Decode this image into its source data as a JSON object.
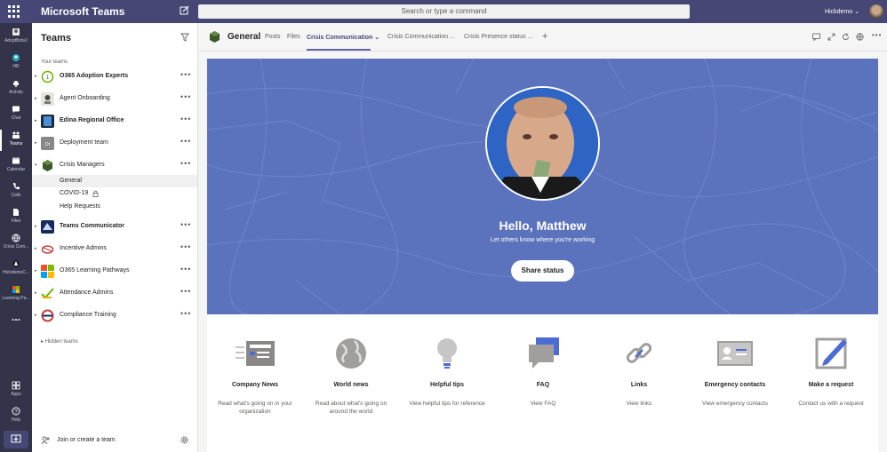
{
  "topbar": {
    "app_title": "Microsoft Teams",
    "search_placeholder": "Search or type a command",
    "user_name": "Hickdemo ⌄"
  },
  "rail": [
    {
      "label": "AdoptBotv2",
      "icon": "bot-icon"
    },
    {
      "label": "HR",
      "icon": "hr-icon"
    },
    {
      "label": "Activity",
      "icon": "bell-icon"
    },
    {
      "label": "Chat",
      "icon": "chat-icon"
    },
    {
      "label": "Teams",
      "icon": "teams-icon",
      "active": true
    },
    {
      "label": "Calendar",
      "icon": "calendar-icon"
    },
    {
      "label": "Calls",
      "icon": "phone-icon"
    },
    {
      "label": "Files",
      "icon": "file-icon"
    },
    {
      "label": "Crisis Com...",
      "icon": "globe-icon"
    },
    {
      "label": "HickdemoC...",
      "icon": "app-icon"
    },
    {
      "label": "Learning Pa...",
      "icon": "learning-icon"
    },
    {
      "label": "...",
      "icon": "more-icon"
    },
    {
      "label": "Apps",
      "icon": "apps-icon"
    },
    {
      "label": "Help",
      "icon": "help-icon"
    }
  ],
  "pane": {
    "title": "Teams",
    "your_teams": "Your teams",
    "hidden_teams": "Hidden teams",
    "join_label": "Join or create a team",
    "teams": [
      {
        "name": "O365 Adoption Experts",
        "bold": true
      },
      {
        "name": "Agent Onboarding",
        "bold": false
      },
      {
        "name": "Edina Regional Office",
        "bold": true
      },
      {
        "name": "Deployment team",
        "bold": false
      },
      {
        "name": "Crisis Managers",
        "bold": false
      },
      {
        "name": "Teams Communicator",
        "bold": true
      },
      {
        "name": "Incentive Admins",
        "bold": false
      },
      {
        "name": "O365 Learning Pathways",
        "bold": false
      },
      {
        "name": "Attendance Admins",
        "bold": false
      },
      {
        "name": "Compliance Training",
        "bold": false
      }
    ],
    "channels": [
      "General",
      "COVID-19",
      "Help Requests"
    ],
    "more": "•••"
  },
  "header": {
    "channel": "General",
    "tabs": [
      "Posts",
      "Files",
      "Crisis Communication ⌄",
      "Crisis Communication ...",
      "Crisis Presence status ..."
    ],
    "add": "+"
  },
  "hero": {
    "greeting": "Hello, Matthew",
    "subtitle": "Let others know where you're working",
    "button": "Share status",
    "color": "#5b72bd"
  },
  "tiles": [
    {
      "title": "Company News",
      "desc": "Read what's going on in your organization",
      "icon": "news-icon"
    },
    {
      "title": "World news",
      "desc": "Read about what's going on around the world",
      "icon": "world-icon"
    },
    {
      "title": "Helpful tips",
      "desc": "View helpful tips for reference",
      "icon": "lightbulb-icon"
    },
    {
      "title": "FAQ",
      "desc": "View FAQ",
      "icon": "faq-icon"
    },
    {
      "title": "Links",
      "desc": "View links",
      "icon": "link-icon"
    },
    {
      "title": "Emergency contacts",
      "desc": "View emergency contacts",
      "icon": "contact-card-icon"
    },
    {
      "title": "Make a request",
      "desc": "Contact us with a request",
      "icon": "edit-icon"
    }
  ]
}
